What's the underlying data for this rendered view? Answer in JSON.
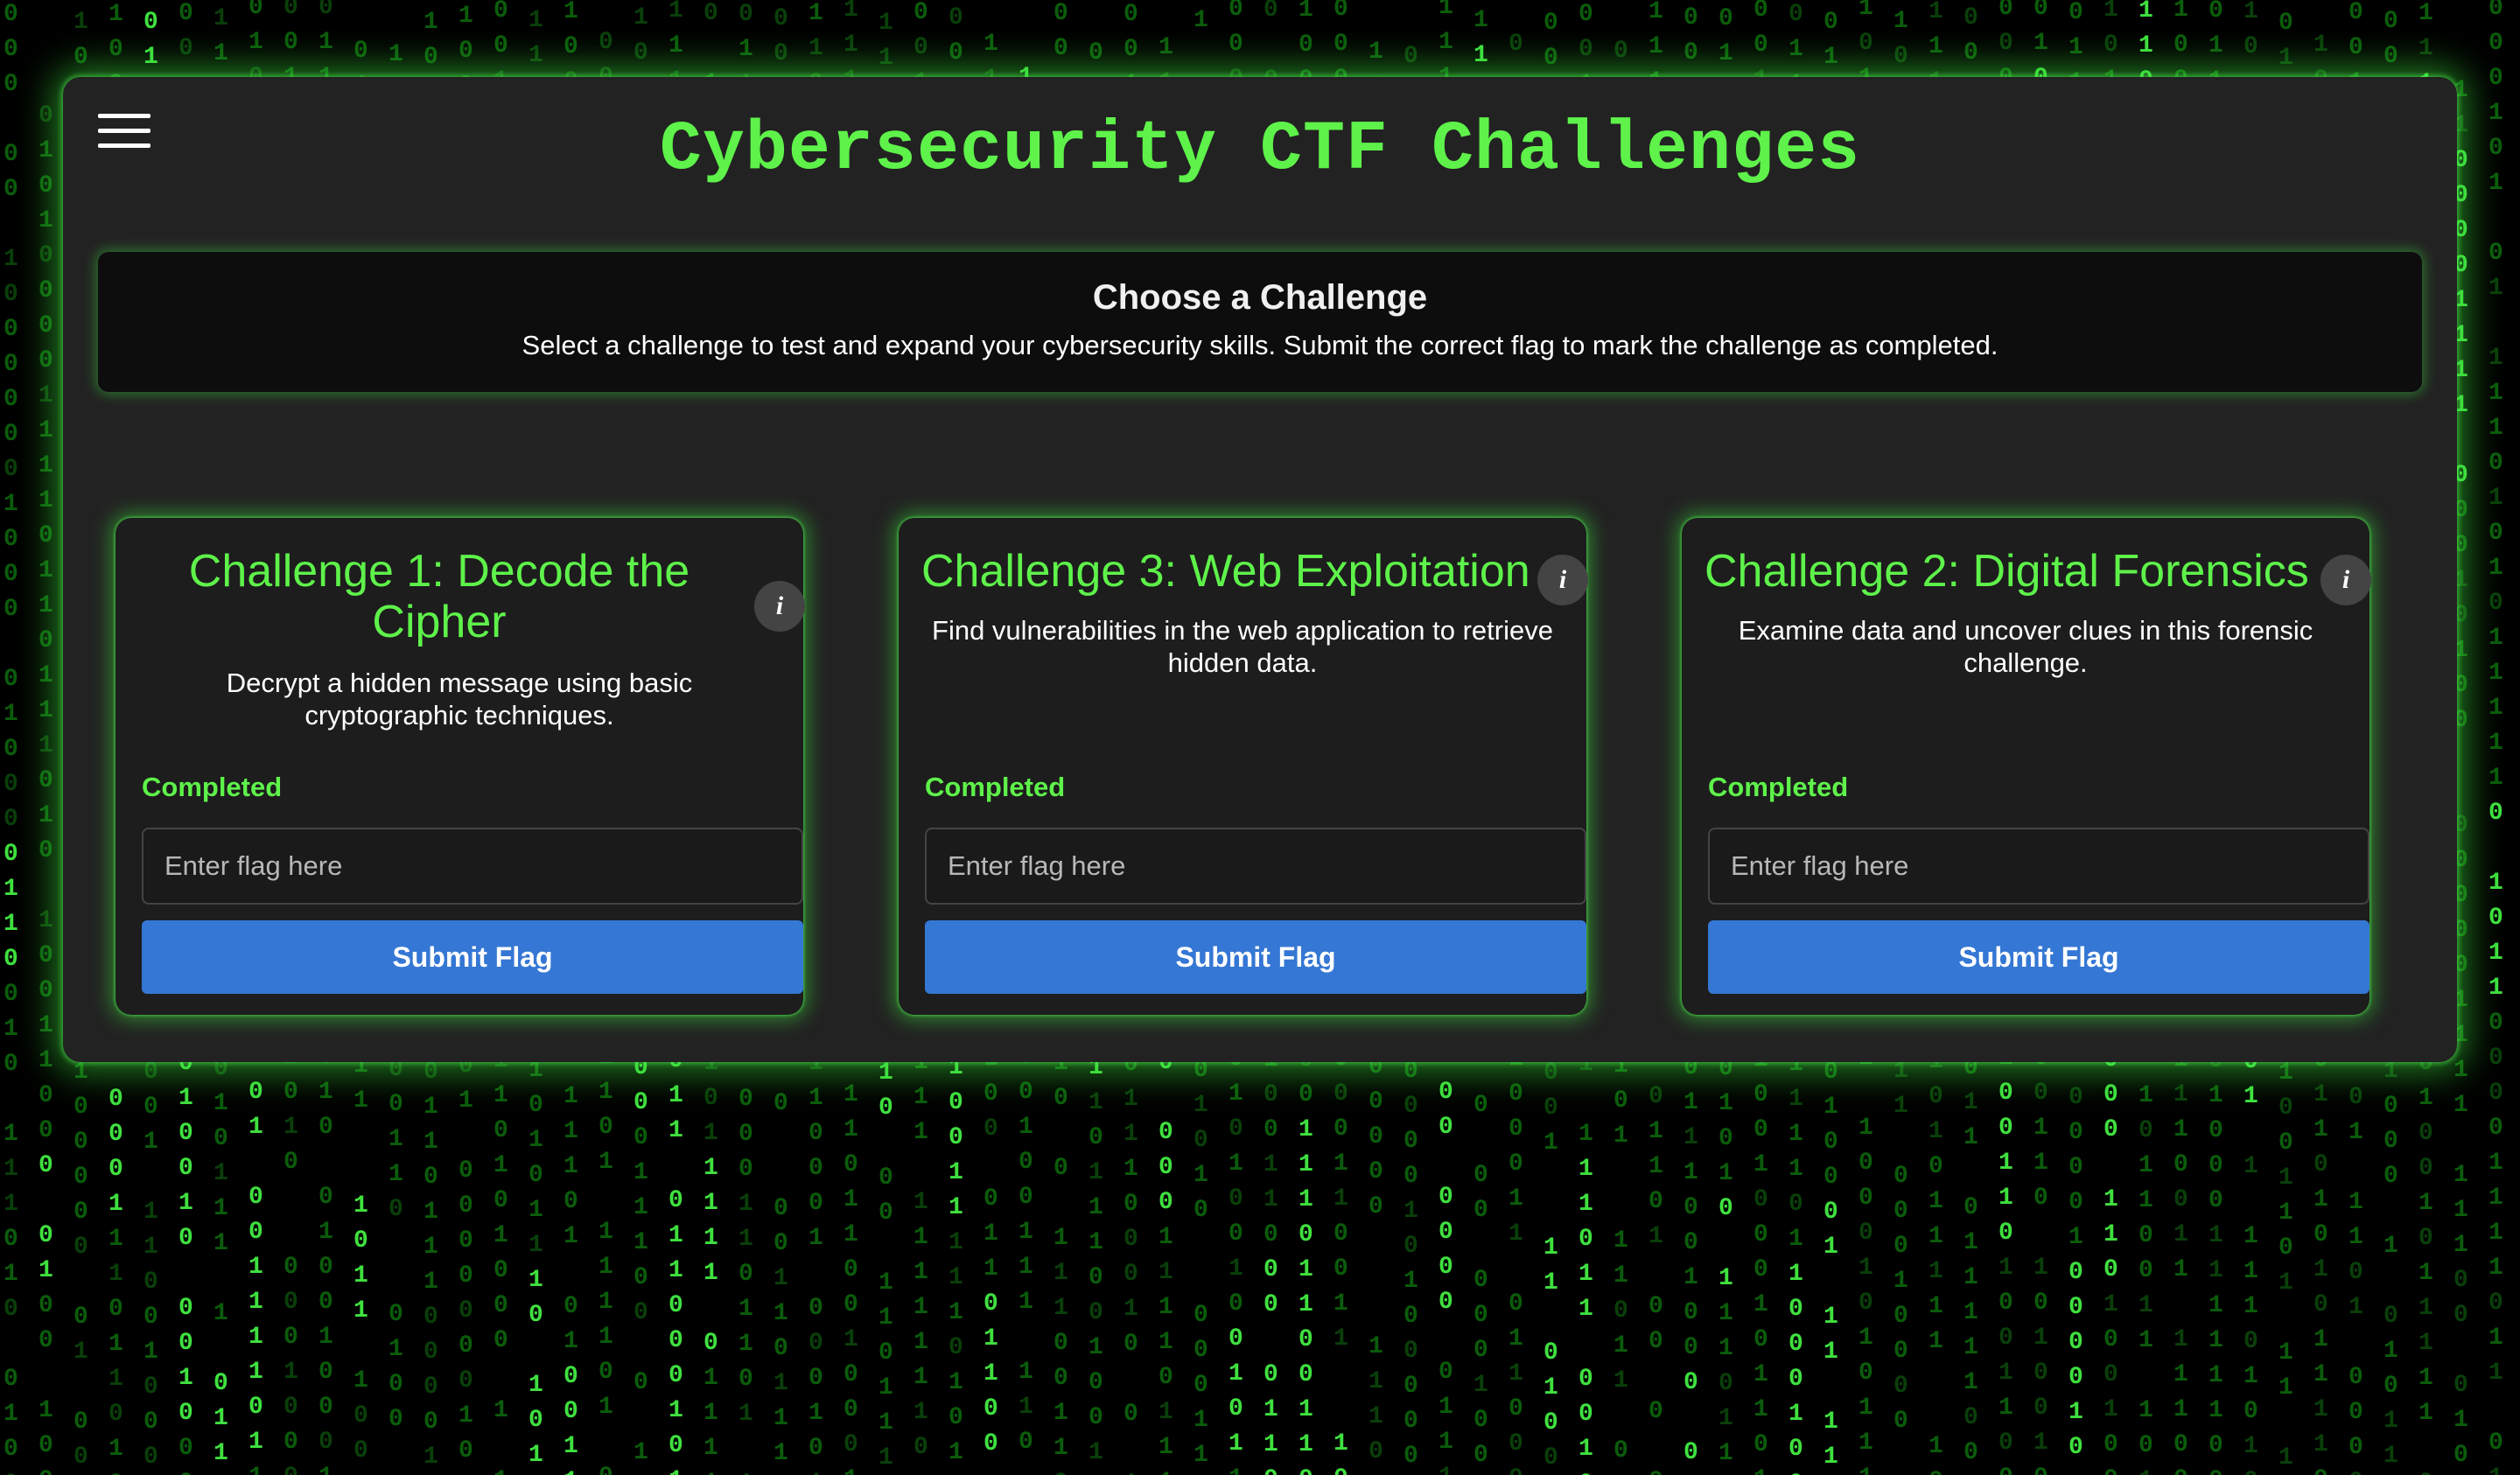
{
  "header": {
    "title": "Cybersecurity CTF Challenges",
    "menu_icon": "hamburger-menu-icon"
  },
  "intro": {
    "heading": "Choose a Challenge",
    "text": "Select a challenge to test and expand your cybersecurity skills. Submit the correct flag to mark the challenge as completed."
  },
  "challenges": [
    {
      "title": "Challenge 1: Decode the Cipher",
      "description": "Decrypt a hidden message using basic cryptographic techniques.",
      "status": "Completed",
      "flag_placeholder": "Enter flag here",
      "flag_value": "",
      "submit_label": "Submit Flag",
      "info_icon": "i"
    },
    {
      "title": "Challenge 3: Web Exploitation",
      "description": "Find vulnerabilities in the web application to retrieve hidden data.",
      "status": "Completed",
      "flag_placeholder": "Enter flag here",
      "flag_value": "",
      "submit_label": "Submit Flag",
      "info_icon": "i"
    },
    {
      "title": "Challenge 2: Digital Forensics",
      "description": "Examine data and uncover clues in this forensic challenge.",
      "status": "Completed",
      "flag_placeholder": "Enter flag here",
      "flag_value": "",
      "submit_label": "Submit Flag",
      "info_icon": "i"
    }
  ],
  "colors": {
    "accent_green": "#5ef24a",
    "button_blue": "#3577d4",
    "panel_bg": "#222222"
  }
}
